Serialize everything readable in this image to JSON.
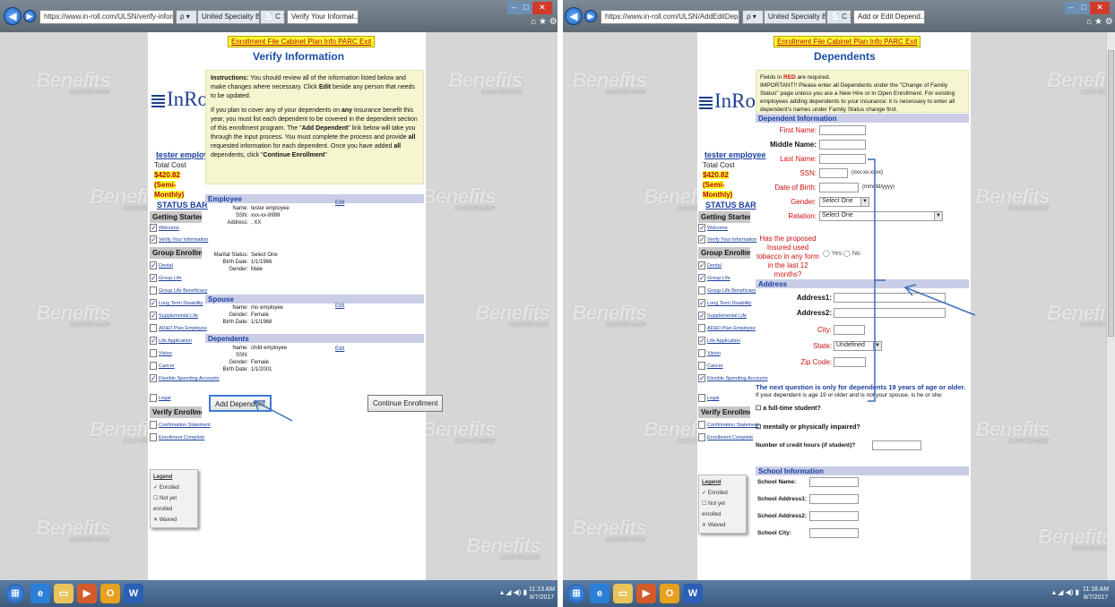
{
  "left": {
    "browser": {
      "address": "https://www.in-roll.com/ULSN/verify-information.aspx?RGT=P0D",
      "search_glyph": "ρ ▾",
      "tabs": [
        "United Specialty Benefits ... ",
        "Verify Your Informat... ×"
      ],
      "addr_controls": "📄 C ✕"
    },
    "topbar": "Enrollment File Cabinet Plan Info PARC Exit",
    "title": "Verify Information",
    "logo": "InRoll",
    "user": {
      "name": "tester employee",
      "total_cost_label": "Total Cost",
      "total_cost": "$420.82",
      "freq": "(Semi-Monthly)"
    },
    "sidebar": {
      "title": "STATUS BAR",
      "heads": [
        "Getting Started",
        "Group Enrollment",
        "Verify Enrollment"
      ],
      "items_getting": [
        {
          "label": "Welcome",
          "check": "✓"
        },
        {
          "label": "Verify Your Information",
          "check": "✓"
        }
      ],
      "items_group": [
        {
          "label": "Dental",
          "check": "✓"
        },
        {
          "label": "Group Life",
          "check": "✓"
        },
        {
          "label": "Group Life Beneficiary",
          "check": ""
        },
        {
          "label": "Long Term Disability",
          "check": "✓"
        },
        {
          "label": "Supplemental Life",
          "check": "✓"
        },
        {
          "label": "AD&D Plan Employee",
          "check": ""
        },
        {
          "label": "Life Application",
          "check": "✓"
        },
        {
          "label": "Vision",
          "check": ""
        },
        {
          "label": "Cancer",
          "check": ""
        },
        {
          "label": "Flexible Spending Accounts",
          "check": "✓"
        },
        {
          "label": "Legal",
          "check": ""
        }
      ],
      "items_verify": [
        {
          "label": "Confirmation Statement",
          "check": ""
        },
        {
          "label": "Enrollment Complete",
          "check": ""
        }
      ]
    },
    "legend": {
      "title": "Legend",
      "items": [
        "✓ Enrolled",
        "☐ Not yet enrolled",
        "✕ Waived"
      ]
    },
    "instructions": {
      "p1_bold": "Instructions:",
      "p1_a": " You should review all of the information listed below and make changes where necessary. Click ",
      "p1_b": "Edit",
      "p1_c": " beside any person that needs to be updated.",
      "p2_a": "If you plan to cover any of your dependents on ",
      "p2_b": "any",
      "p2_c": " insurance benefit this year, you must list each dependent to be covered in the dependent section of this enrollment program. The \"",
      "p2_d": "Add Dependent",
      "p2_e": "\" link below will take you through the input process. You must complete the process and provide ",
      "p2_f": "all",
      "p2_g": " requested information for each dependent. Once you have added ",
      "p2_h": "all",
      "p2_i": " dependents, click \"",
      "p2_j": "Continue Enrollment",
      "p2_k": "\""
    },
    "employee": {
      "section": "Employee",
      "edit": "Edit",
      "name_label": "Name:",
      "name": "tester employee",
      "ssn_label": "SSN:",
      "ssn": "xxx-xx-9999",
      "address_label": "Address:",
      "address": ", XX",
      "marital_label": "Marital Status:",
      "marital": "Select One",
      "birth_label": "Birth Date:",
      "birth": "1/1/1966",
      "gender_label": "Gender:",
      "gender": "Male"
    },
    "spouse": {
      "section": "Spouse",
      "edit": "Edit",
      "name_label": "Name:",
      "name": "mo employee",
      "gender_label": "Gender:",
      "gender": "Female",
      "birth_label": "Birth Date:",
      "birth": "1/1/1968"
    },
    "dependents": {
      "section": "Dependents",
      "edit": "Edit",
      "name_label": "Name:",
      "name": "child employee",
      "ssn_label": "SSN:",
      "ssn": "",
      "gender_label": "Gender:",
      "gender": "Female",
      "birth_label": "Birth Date:",
      "birth": "1/1/2001"
    },
    "buttons": {
      "add_dependent": "Add Dependent",
      "continue": "Continue Enrollment"
    }
  },
  "right": {
    "browser": {
      "address": "https://www.in-roll.com/ULSN/AddEditDependent.aspx",
      "search_glyph": "ρ ▾",
      "tabs": [
        "United Specialty Benefits ... ",
        "Add or Edit Depend... ×"
      ],
      "addr_controls": "📄 C ✕"
    },
    "topbar": "Enrollment File Cabinet Plan Info PARC Exit",
    "title": "Dependents",
    "logo": "InRoll",
    "user": {
      "name": "tester employee",
      "total_cost_label": "Total Cost",
      "total_cost": "$420.82",
      "freq": "(Semi-Monthly)"
    },
    "notice": {
      "l1_a": "Fields in ",
      "l1_b": "RED",
      "l1_c": " are required.",
      "l2": "IMPORTANT!! Please enter all Dependents under the \"Change of Family Status\" page unless you are a New Hire or in Open Enrollment. For existing employees adding dependents to your insurance: it is necessary to enter all dependent's names under Family Status change first."
    },
    "dep_info_header": "Dependent Information",
    "fields": {
      "first": "First Name:",
      "middle": "Middle Name:",
      "last": "Last Name:",
      "ssn": "SSN:",
      "ssn_hint": "(xxx-xx-xxxx)",
      "dob": "Date of Birth:",
      "dob_hint": "(mm/dd/yyyy)",
      "gender": "Gender:",
      "gender_value": "Select One",
      "relation": "Relation:",
      "relation_value": "Select One",
      "tobacco_q": "Has the proposed Insured used tobacco in any form in the last 12 months?",
      "tobacco_yes": "Yes",
      "tobacco_no": "No"
    },
    "address_header": "Address",
    "address": {
      "a1": "Address1:",
      "a2": "Address2:",
      "city": "City:",
      "state": "State:",
      "state_value": "Undefined",
      "zip": "Zip Code:"
    },
    "age_note": "The next question is only for dependents 19 years of age or older.",
    "age_q": "If your dependent is age 19 or older and is not your spouse, is he or she:",
    "fulltime": "a full-time student?",
    "impaired": "mentally or physically impaired?",
    "credit_hours": "Number of credit hours (if student)?",
    "school_header": "School Information",
    "school": {
      "name": "School Name:",
      "addr1": "School Address1:",
      "addr2": "School Address2:",
      "city": "School City:"
    }
  },
  "taskbar": {
    "left_time": "11:13 AM",
    "left_date": "8/7/2017",
    "right_time": "11:18 AM",
    "right_date": "8/7/2017"
  },
  "watermark": {
    "title": "Benefits",
    "sub": "coordinator"
  },
  "colors": {
    "accent": "#1a4fa3",
    "required": "#cc1111",
    "highlight": "#ffff33",
    "arrow": "#3b6fb8"
  }
}
